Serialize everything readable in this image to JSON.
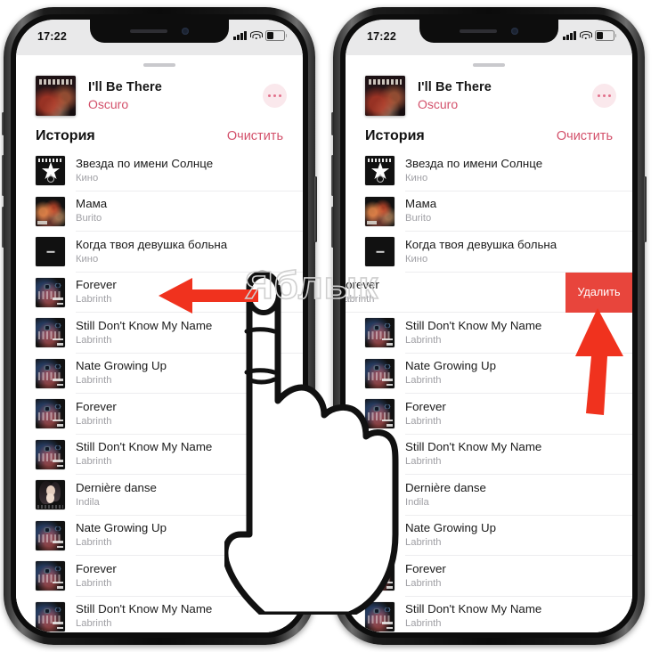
{
  "meta": {
    "watermark": "Яблык",
    "accent_pink": "#d3516b",
    "delete_red": "#e8453c",
    "arrow_red": "#f0321e",
    "statusbar_bg": "#e9e9ea"
  },
  "status_bar": {
    "time": "17:22",
    "signal_icon": "cellular-signal-icon",
    "wifi_icon": "wifi-icon",
    "battery_icon": "battery-icon"
  },
  "now_playing": {
    "title": "I'll Be There",
    "artist": "Oscuro",
    "more_icon": "more-options-icon",
    "artwork": "album-art-ill-be-there"
  },
  "history": {
    "title": "История",
    "clear_label": "Очистить"
  },
  "delete_action": {
    "label": "Удалить"
  },
  "tracks_left": [
    {
      "title": "Звезда по имени Солнце",
      "artist": "Кино",
      "art": "art-star"
    },
    {
      "title": "Мама",
      "artist": "Burito",
      "art": "art-city"
    },
    {
      "title": "Когда твоя девушка больна",
      "artist": "Кино",
      "art": "art-black"
    },
    {
      "title": "Forever",
      "artist": "Labrinth",
      "art": "art-lab"
    },
    {
      "title": "Still Don't Know My Name",
      "artist": "Labrinth",
      "art": "art-lab"
    },
    {
      "title": "Nate Growing Up",
      "artist": "Labrinth",
      "art": "art-lab"
    },
    {
      "title": "Forever",
      "artist": "Labrinth",
      "art": "art-lab"
    },
    {
      "title": "Still Don't Know My Name",
      "artist": "Labrinth",
      "art": "art-lab"
    },
    {
      "title": "Dernière danse",
      "artist": "Indila",
      "art": "art-indila"
    },
    {
      "title": "Nate Growing Up",
      "artist": "Labrinth",
      "art": "art-lab"
    },
    {
      "title": "Forever",
      "artist": "Labrinth",
      "art": "art-lab"
    },
    {
      "title": "Still Don't Know My Name",
      "artist": "Labrinth",
      "art": "art-lab"
    }
  ],
  "tracks_right": [
    {
      "title": "Звезда по имени Солнце",
      "artist": "Кино",
      "art": "art-star"
    },
    {
      "title": "Мама",
      "artist": "Burito",
      "art": "art-city"
    },
    {
      "title": "Когда твоя девушка больна",
      "artist": "Кино",
      "art": "art-black"
    },
    {
      "title": "Forever",
      "artist": "Labrinth",
      "art": "art-lab",
      "swiped": true
    },
    {
      "title": "Still Don't Know My Name",
      "artist": "Labrinth",
      "art": "art-lab"
    },
    {
      "title": "Nate Growing Up",
      "artist": "Labrinth",
      "art": "art-lab"
    },
    {
      "title": "Forever",
      "artist": "Labrinth",
      "art": "art-lab"
    },
    {
      "title": "Still Don't Know My Name",
      "artist": "Labrinth",
      "art": "art-lab"
    },
    {
      "title": "Dernière danse",
      "artist": "Indila",
      "art": "art-indila"
    },
    {
      "title": "Nate Growing Up",
      "artist": "Labrinth",
      "art": "art-lab"
    },
    {
      "title": "Forever",
      "artist": "Labrinth",
      "art": "art-lab"
    },
    {
      "title": "Still Don't Know My Name",
      "artist": "Labrinth",
      "art": "art-lab"
    }
  ],
  "annotations": {
    "hand_icon": "pointing-hand-illustration",
    "arrow_left_icon": "swipe-left-arrow",
    "arrow_up_icon": "tap-delete-arrow"
  }
}
